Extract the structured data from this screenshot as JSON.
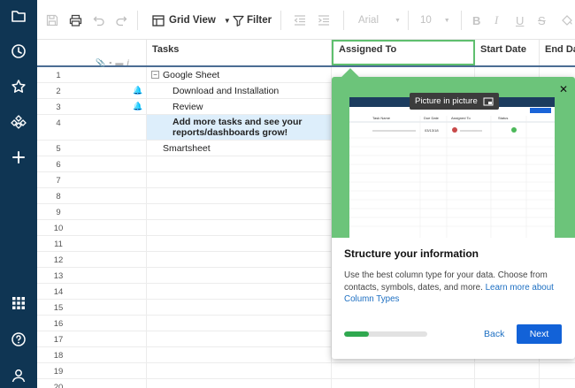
{
  "nav": {
    "items": [
      {
        "id": "browse",
        "icon": "folder-icon"
      },
      {
        "id": "recents",
        "icon": "clock-icon"
      },
      {
        "id": "favorites",
        "icon": "star-icon"
      },
      {
        "id": "workapps",
        "icon": "workapps-icon"
      },
      {
        "id": "create",
        "icon": "plus-icon"
      },
      {
        "id": "launcher",
        "icon": "grid-icon"
      },
      {
        "id": "help",
        "icon": "help-icon"
      },
      {
        "id": "account",
        "icon": "user-icon"
      }
    ]
  },
  "toolbar": {
    "view_label": "Grid View",
    "filter_label": "Filter",
    "font_name": "Arial",
    "font_size": "10"
  },
  "grid": {
    "columns": {
      "tasks": "Tasks",
      "assigned_to": "Assigned To",
      "start_date": "Start Date",
      "end_date": "End Da"
    },
    "rows": [
      {
        "num": "1",
        "task": "Google Sheet",
        "level": 0,
        "parent": true,
        "reminder": false
      },
      {
        "num": "2",
        "task": "Download and Installation",
        "level": 1,
        "reminder": true
      },
      {
        "num": "3",
        "task": "Review",
        "level": 1,
        "reminder": true
      },
      {
        "num": "4",
        "task": "Add more tasks and see your reports/dashboards grow!",
        "level": 1,
        "bold": true,
        "highlight": true
      },
      {
        "num": "5",
        "task": "Smartsheet",
        "level": 0
      },
      {
        "num": "6"
      },
      {
        "num": "7"
      },
      {
        "num": "8"
      },
      {
        "num": "9"
      },
      {
        "num": "10"
      },
      {
        "num": "11"
      },
      {
        "num": "12"
      },
      {
        "num": "13"
      },
      {
        "num": "14"
      },
      {
        "num": "15"
      },
      {
        "num": "16"
      },
      {
        "num": "17"
      },
      {
        "num": "18"
      },
      {
        "num": "19"
      },
      {
        "num": "20"
      }
    ]
  },
  "panel": {
    "pip_label": "Picture in picture",
    "preview": {
      "columns": [
        "Task Name",
        "Due Date",
        "Assigned To",
        "Status"
      ],
      "due_date": "03/13/18"
    },
    "title": "Structure your information",
    "body": "Use the best column type for your data. Choose from contacts, symbols, dates, and more.",
    "link": "Learn more about Column Types",
    "progress_fraction": 0.3,
    "back_label": "Back",
    "next_label": "Next"
  },
  "colors": {
    "nav_bg": "#0f3553",
    "accent_green": "#6cc47a",
    "primary_blue": "#1262d8",
    "link_blue": "#1d6fc2",
    "row_highlight": "#ddeefb"
  }
}
